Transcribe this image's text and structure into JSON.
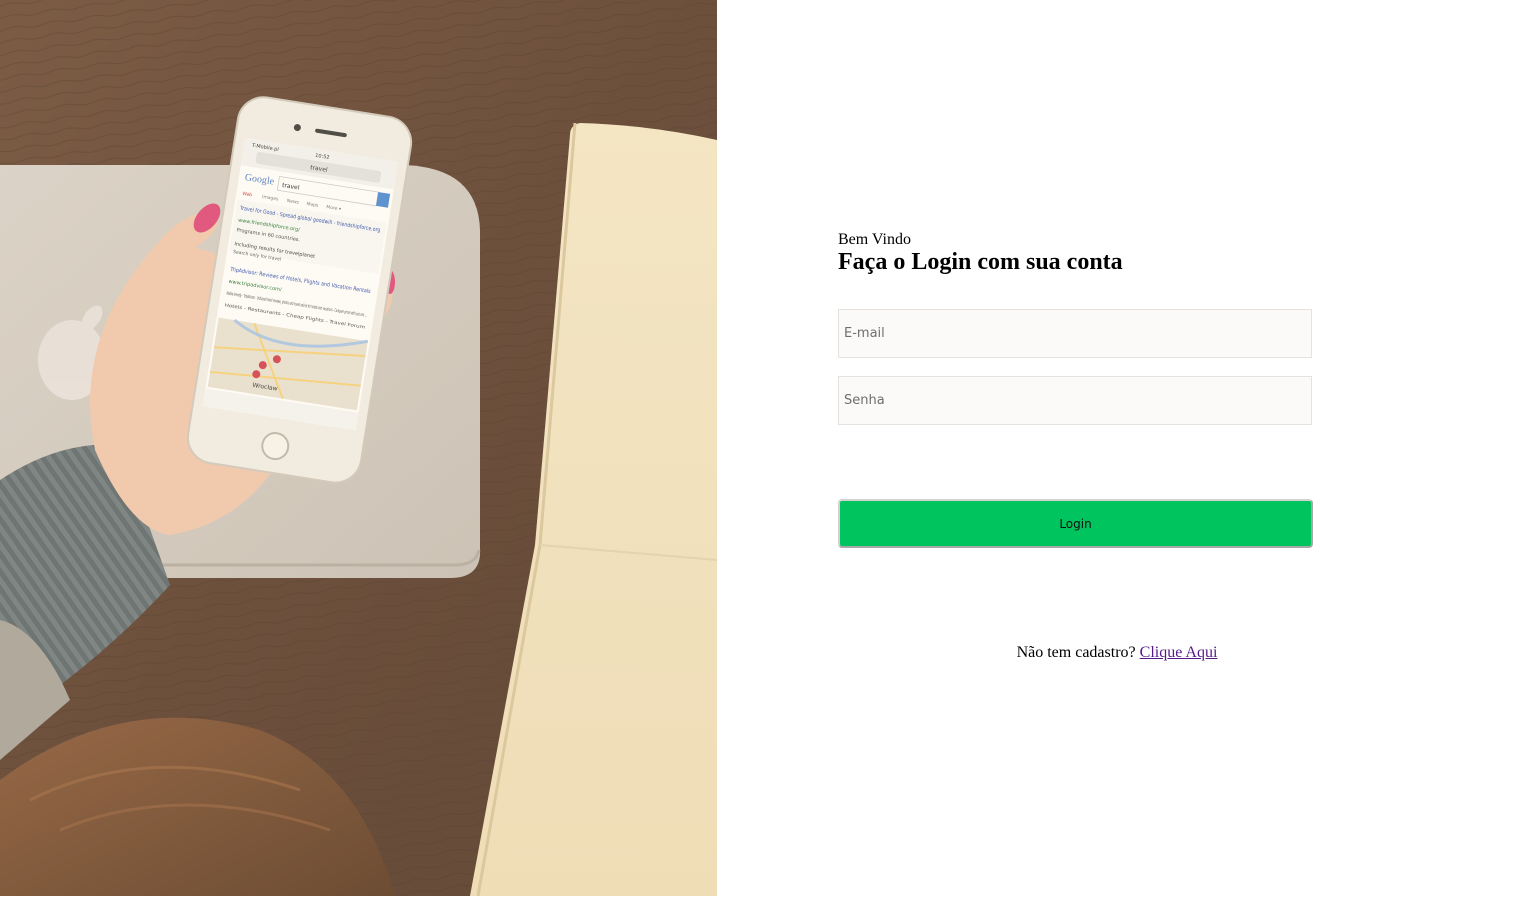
{
  "photo": {
    "icon": "hero-photo-hand-holding-smartphone",
    "phone_screen": {
      "carrier": "T-Mobile.pl",
      "time": "10:52",
      "address_bar": "travel",
      "logo": "Google",
      "search_query": "travel",
      "tabs": [
        "Web",
        "Images",
        "News",
        "Maps",
        "More ▾"
      ],
      "result_1_title": "Travel for Good - Spread global goodwill - friendshipforce.org",
      "result_1_url": "www.friendshipforce.org/",
      "result_1_snippet": "Programs in 60 countries.",
      "including_results": "Including results for travelplanet",
      "search_only": "Search only for travel",
      "result_2_title": "TripAdvisor: Reviews of Hotels, Flights and Vacation Rentals",
      "result_2_url": "www.tripadvisor.com/",
      "result_2_snippet": "Mobile-friendly - TripAdvisor - Unbiased hotel reviews, photos and travel advice for hotels and vacations - Compare prices with just one ...",
      "result_2_links": "Hotels - Restaurants - Cheap Flights - Travel Forum",
      "map_label": "Wrocław"
    }
  },
  "login": {
    "welcome": "Bem Vindo",
    "heading": "Faça o Login com sua conta",
    "email_placeholder": "E-mail",
    "password_placeholder": "Senha",
    "button_label": "Login",
    "signup_prompt": "Não tem cadastro?",
    "signup_link": "Clique Aqui"
  },
  "colors": {
    "button": "#00c45d",
    "field_bg": "#fbfaf8",
    "link": "#551a8b"
  }
}
